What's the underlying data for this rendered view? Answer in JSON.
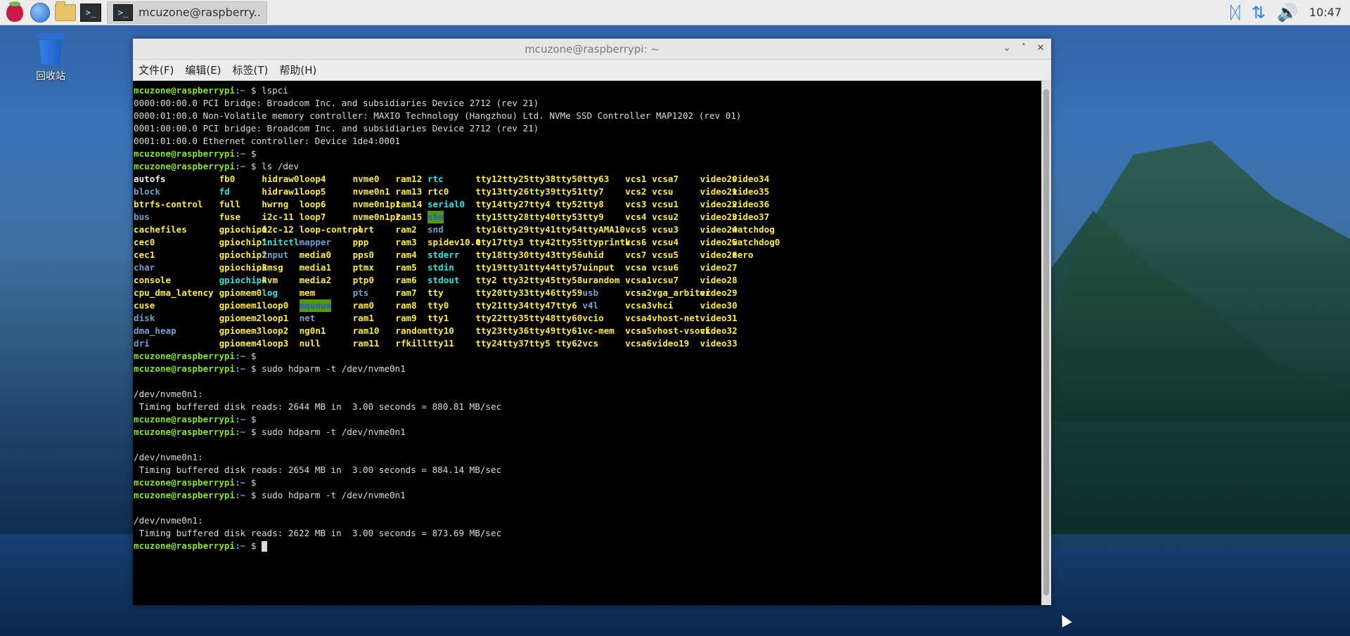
{
  "taskbar": {
    "launchers": [
      {
        "name": "raspberry-menu-icon"
      },
      {
        "name": "web-browser-icon"
      },
      {
        "name": "file-manager-icon"
      },
      {
        "name": "terminal-launcher-icon"
      }
    ],
    "task_label": "mcuzone@raspberry..",
    "task_icon_glyph": ">_",
    "clock": "10:47",
    "tray": [
      "bluetooth-icon",
      "network-icon",
      "volume-icon"
    ]
  },
  "desktop": {
    "trash_label": "回收站"
  },
  "window": {
    "title": "mcuzone@raspberrypi: ~",
    "controls": {
      "minimize": "⌄",
      "maximize": "˄",
      "close": "✕"
    },
    "menu": [
      "文件(F)",
      "编辑(E)",
      "标签(T)",
      "帮助(H)"
    ]
  },
  "terminal": {
    "prompt_user": "mcuzone@raspberrypi",
    "prompt_path": ":~",
    "prompt_sym": " $ ",
    "before": [
      {
        "type": "prompt",
        "cmd": "lspci"
      },
      {
        "type": "out",
        "text": "0000:00:00.0 PCI bridge: Broadcom Inc. and subsidiaries Device 2712 (rev 21)"
      },
      {
        "type": "out",
        "text": "0000:01:00.0 Non-Volatile memory controller: MAXIO Technology (Hangzhou) Ltd. NVMe SSD Controller MAP1202 (rev 01)"
      },
      {
        "type": "out",
        "text": "0001:00:00.0 PCI bridge: Broadcom Inc. and subsidiaries Device 2712 (rev 21)"
      },
      {
        "type": "out",
        "text": "0001:01:00.0 Ethernet controller: Device 1de4:0001"
      },
      {
        "type": "prompt",
        "cmd": ""
      },
      {
        "type": "prompt",
        "cmd": "ls /dev"
      }
    ],
    "ls_rows": [
      [
        [
          "autofs",
          "f"
        ],
        [
          "fb0",
          "c"
        ],
        [
          "hidraw0",
          "c"
        ],
        [
          "loop4",
          "c"
        ],
        [
          "nvme0",
          "c"
        ],
        [
          "ram12",
          "c"
        ],
        [
          "rtc",
          "l"
        ],
        [
          "tty12",
          "c"
        ],
        [
          "tty25",
          "c"
        ],
        [
          "tty38",
          "c"
        ],
        [
          "tty50",
          "c"
        ],
        [
          "tty63",
          "c"
        ],
        [
          "vcs1",
          "c"
        ],
        [
          "vcsa7",
          "c"
        ],
        [
          "video20",
          "c"
        ],
        [
          "video34",
          "c"
        ]
      ],
      [
        [
          "block",
          "d"
        ],
        [
          "fd",
          "l"
        ],
        [
          "hidraw1",
          "c"
        ],
        [
          "loop5",
          "c"
        ],
        [
          "nvme0n1",
          "c"
        ],
        [
          "ram13",
          "c"
        ],
        [
          "rtc0",
          "c"
        ],
        [
          "tty13",
          "c"
        ],
        [
          "tty26",
          "c"
        ],
        [
          "tty39",
          "c"
        ],
        [
          "tty51",
          "c"
        ],
        [
          "tty7",
          "c"
        ],
        [
          "vcs2",
          "c"
        ],
        [
          "vcsu",
          "c"
        ],
        [
          "video21",
          "c"
        ],
        [
          "video35",
          "c"
        ]
      ],
      [
        [
          "btrfs-control",
          "c"
        ],
        [
          "full",
          "c"
        ],
        [
          "hwrng",
          "c"
        ],
        [
          "loop6",
          "c"
        ],
        [
          "nvme0n1p1",
          "c"
        ],
        [
          "ram14",
          "c"
        ],
        [
          "serial0",
          "l"
        ],
        [
          "tty14",
          "c"
        ],
        [
          "tty27",
          "c"
        ],
        [
          "tty4",
          "c"
        ],
        [
          "tty52",
          "c"
        ],
        [
          "tty8",
          "c"
        ],
        [
          "vcs3",
          "c"
        ],
        [
          "vcsu1",
          "c"
        ],
        [
          "video22",
          "c"
        ],
        [
          "video36",
          "c"
        ]
      ],
      [
        [
          "bus",
          "d"
        ],
        [
          "fuse",
          "c"
        ],
        [
          "i2c-11",
          "c"
        ],
        [
          "loop7",
          "c"
        ],
        [
          "nvme0n1p2",
          "c"
        ],
        [
          "ram15",
          "c"
        ],
        [
          "shm",
          "s"
        ],
        [
          "tty15",
          "c"
        ],
        [
          "tty28",
          "c"
        ],
        [
          "tty40",
          "c"
        ],
        [
          "tty53",
          "c"
        ],
        [
          "tty9",
          "c"
        ],
        [
          "vcs4",
          "c"
        ],
        [
          "vcsu2",
          "c"
        ],
        [
          "video23",
          "c"
        ],
        [
          "video37",
          "c"
        ]
      ],
      [
        [
          "cachefiles",
          "c"
        ],
        [
          "gpiochip0",
          "c"
        ],
        [
          "i2c-12",
          "c"
        ],
        [
          "loop-control",
          "c"
        ],
        [
          "port",
          "c"
        ],
        [
          "ram2",
          "c"
        ],
        [
          "snd",
          "d"
        ],
        [
          "tty16",
          "c"
        ],
        [
          "tty29",
          "c"
        ],
        [
          "tty41",
          "c"
        ],
        [
          "tty54",
          "c"
        ],
        [
          "ttyAMA10",
          "c"
        ],
        [
          "vcs5",
          "c"
        ],
        [
          "vcsu3",
          "c"
        ],
        [
          "video24",
          "c"
        ],
        [
          "watchdog",
          "c"
        ]
      ],
      [
        [
          "cec0",
          "c"
        ],
        [
          "gpiochip1",
          "c"
        ],
        [
          "initctl",
          "l"
        ],
        [
          "mapper",
          "d"
        ],
        [
          "ppp",
          "c"
        ],
        [
          "ram3",
          "c"
        ],
        [
          "spidev10.0",
          "c"
        ],
        [
          "tty17",
          "c"
        ],
        [
          "tty3",
          "c"
        ],
        [
          "tty42",
          "c"
        ],
        [
          "tty55",
          "c"
        ],
        [
          "ttyprintk",
          "c"
        ],
        [
          "vcs6",
          "c"
        ],
        [
          "vcsu4",
          "c"
        ],
        [
          "video25",
          "c"
        ],
        [
          "watchdog0",
          "c"
        ]
      ],
      [
        [
          "cec1",
          "c"
        ],
        [
          "gpiochip2",
          "c"
        ],
        [
          "input",
          "d"
        ],
        [
          "media0",
          "c"
        ],
        [
          "pps0",
          "c"
        ],
        [
          "ram4",
          "c"
        ],
        [
          "stderr",
          "l"
        ],
        [
          "tty18",
          "c"
        ],
        [
          "tty30",
          "c"
        ],
        [
          "tty43",
          "c"
        ],
        [
          "tty56",
          "c"
        ],
        [
          "uhid",
          "c"
        ],
        [
          "vcs7",
          "c"
        ],
        [
          "vcsu5",
          "c"
        ],
        [
          "video26",
          "c"
        ],
        [
          "zero",
          "c"
        ]
      ],
      [
        [
          "char",
          "d"
        ],
        [
          "gpiochip3",
          "c"
        ],
        [
          "kmsg",
          "c"
        ],
        [
          "media1",
          "c"
        ],
        [
          "ptmx",
          "c"
        ],
        [
          "ram5",
          "c"
        ],
        [
          "stdin",
          "l"
        ],
        [
          "tty19",
          "c"
        ],
        [
          "tty31",
          "c"
        ],
        [
          "tty44",
          "c"
        ],
        [
          "tty57",
          "c"
        ],
        [
          "uinput",
          "c"
        ],
        [
          "vcsa",
          "c"
        ],
        [
          "vcsu6",
          "c"
        ],
        [
          "video27",
          "c"
        ],
        [
          "",
          ""
        ]
      ],
      [
        [
          "console",
          "c"
        ],
        [
          "gpiochip4",
          "l"
        ],
        [
          "kvm",
          "c"
        ],
        [
          "media2",
          "c"
        ],
        [
          "ptp0",
          "c"
        ],
        [
          "ram6",
          "c"
        ],
        [
          "stdout",
          "l"
        ],
        [
          "tty2",
          "c"
        ],
        [
          "tty32",
          "c"
        ],
        [
          "tty45",
          "c"
        ],
        [
          "tty58",
          "c"
        ],
        [
          "urandom",
          "c"
        ],
        [
          "vcsa1",
          "c"
        ],
        [
          "vcsu7",
          "c"
        ],
        [
          "video28",
          "c"
        ],
        [
          "",
          ""
        ]
      ],
      [
        [
          "cpu_dma_latency",
          "c"
        ],
        [
          "gpiomem0",
          "c"
        ],
        [
          "log",
          "l"
        ],
        [
          "mem",
          "c"
        ],
        [
          "pts",
          "d"
        ],
        [
          "ram7",
          "c"
        ],
        [
          "tty",
          "c"
        ],
        [
          "tty20",
          "c"
        ],
        [
          "tty33",
          "c"
        ],
        [
          "tty46",
          "c"
        ],
        [
          "tty59",
          "c"
        ],
        [
          "usb",
          "d"
        ],
        [
          "vcsa2",
          "c"
        ],
        [
          "vga_arbiter",
          "c"
        ],
        [
          "video29",
          "c"
        ],
        [
          "",
          ""
        ]
      ],
      [
        [
          "cuse",
          "c"
        ],
        [
          "gpiomem1",
          "c"
        ],
        [
          "loop0",
          "c"
        ],
        [
          "mqueue",
          "s"
        ],
        [
          "ram0",
          "c"
        ],
        [
          "ram8",
          "c"
        ],
        [
          "tty0",
          "c"
        ],
        [
          "tty21",
          "c"
        ],
        [
          "tty34",
          "c"
        ],
        [
          "tty47",
          "c"
        ],
        [
          "tty6",
          "c"
        ],
        [
          "v4l",
          "d"
        ],
        [
          "vcsa3",
          "c"
        ],
        [
          "vhci",
          "c"
        ],
        [
          "video30",
          "c"
        ],
        [
          "",
          ""
        ]
      ],
      [
        [
          "disk",
          "d"
        ],
        [
          "gpiomem2",
          "c"
        ],
        [
          "loop1",
          "c"
        ],
        [
          "net",
          "d"
        ],
        [
          "ram1",
          "c"
        ],
        [
          "ram9",
          "c"
        ],
        [
          "tty1",
          "c"
        ],
        [
          "tty22",
          "c"
        ],
        [
          "tty35",
          "c"
        ],
        [
          "tty48",
          "c"
        ],
        [
          "tty60",
          "c"
        ],
        [
          "vcio",
          "c"
        ],
        [
          "vcsa4",
          "c"
        ],
        [
          "vhost-net",
          "c"
        ],
        [
          "video31",
          "c"
        ],
        [
          "",
          ""
        ]
      ],
      [
        [
          "dma_heap",
          "d"
        ],
        [
          "gpiomem3",
          "c"
        ],
        [
          "loop2",
          "c"
        ],
        [
          "ng0n1",
          "c"
        ],
        [
          "ram10",
          "c"
        ],
        [
          "random",
          "c"
        ],
        [
          "tty10",
          "c"
        ],
        [
          "tty23",
          "c"
        ],
        [
          "tty36",
          "c"
        ],
        [
          "tty49",
          "c"
        ],
        [
          "tty61",
          "c"
        ],
        [
          "vc-mem",
          "c"
        ],
        [
          "vcsa5",
          "c"
        ],
        [
          "vhost-vsock",
          "c"
        ],
        [
          "video32",
          "c"
        ],
        [
          "",
          ""
        ]
      ],
      [
        [
          "dri",
          "d"
        ],
        [
          "gpiomem4",
          "c"
        ],
        [
          "loop3",
          "c"
        ],
        [
          "null",
          "c"
        ],
        [
          "ram11",
          "c"
        ],
        [
          "rfkill",
          "c"
        ],
        [
          "tty11",
          "c"
        ],
        [
          "tty24",
          "c"
        ],
        [
          "tty37",
          "c"
        ],
        [
          "tty5",
          "c"
        ],
        [
          "tty62",
          "c"
        ],
        [
          "vcs",
          "c"
        ],
        [
          "vcsa6",
          "c"
        ],
        [
          "video19",
          "c"
        ],
        [
          "video33",
          "c"
        ],
        [
          "",
          ""
        ]
      ]
    ],
    "after": [
      {
        "type": "prompt",
        "cmd": ""
      },
      {
        "type": "prompt",
        "cmd": "sudo hdparm -t /dev/nvme0n1"
      },
      {
        "type": "out",
        "text": ""
      },
      {
        "type": "out",
        "text": "/dev/nvme0n1:"
      },
      {
        "type": "out",
        "text": " Timing buffered disk reads: 2644 MB in  3.00 seconds = 880.81 MB/sec"
      },
      {
        "type": "prompt",
        "cmd": ""
      },
      {
        "type": "prompt",
        "cmd": "sudo hdparm -t /dev/nvme0n1"
      },
      {
        "type": "out",
        "text": ""
      },
      {
        "type": "out",
        "text": "/dev/nvme0n1:"
      },
      {
        "type": "out",
        "text": " Timing buffered disk reads: 2654 MB in  3.00 seconds = 884.14 MB/sec"
      },
      {
        "type": "prompt",
        "cmd": ""
      },
      {
        "type": "prompt",
        "cmd": "sudo hdparm -t /dev/nvme0n1"
      },
      {
        "type": "out",
        "text": ""
      },
      {
        "type": "out",
        "text": "/dev/nvme0n1:"
      },
      {
        "type": "out",
        "text": " Timing buffered disk reads: 2622 MB in  3.00 seconds = 873.69 MB/sec"
      },
      {
        "type": "cursor",
        "cmd": ""
      }
    ]
  }
}
